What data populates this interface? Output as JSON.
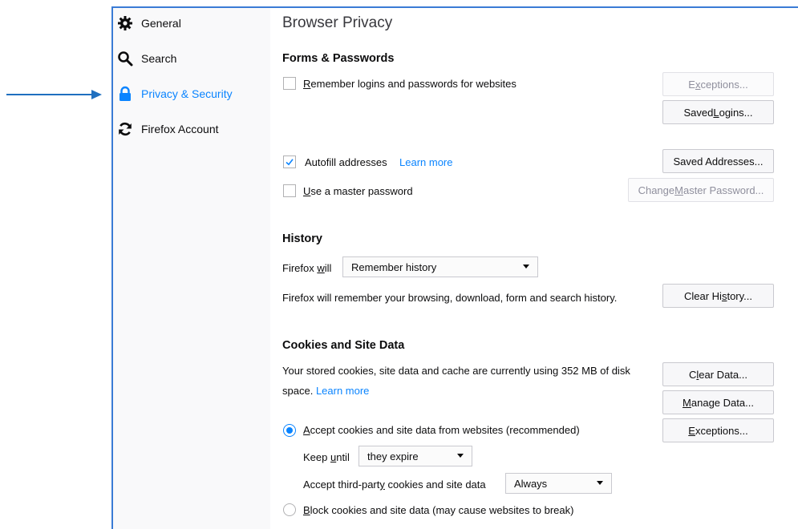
{
  "sidebar": {
    "items": [
      {
        "label": "General",
        "icon": "gear-icon"
      },
      {
        "label": "Search",
        "icon": "search-icon"
      },
      {
        "label": "Privacy & Security",
        "icon": "lock-icon",
        "selected": true
      },
      {
        "label": "Firefox Account",
        "icon": "sync-icon"
      }
    ]
  },
  "pane": {
    "title": "Browser Privacy"
  },
  "forms": {
    "heading": "Forms & Passwords",
    "remember_logins": {
      "pre": "",
      "u": "R",
      "post": "emember logins and passwords for websites",
      "checked": false
    },
    "exceptions_btn": {
      "pre": "E",
      "u": "x",
      "post": "ceptions..."
    },
    "saved_logins_btn": {
      "pre": "Saved ",
      "u": "L",
      "post": "ogins..."
    },
    "autofill": {
      "label": "Autofill addresses",
      "checked": true
    },
    "autofill_learn_more": "Learn more",
    "saved_addresses_btn": "Saved Addresses...",
    "master_password": {
      "pre": "",
      "u": "U",
      "post": "se a master password",
      "checked": false
    },
    "change_master_btn": {
      "pre": "Change ",
      "u": "M",
      "post": "aster Password..."
    }
  },
  "history": {
    "heading": "History",
    "will_label": {
      "pre": "Firefox ",
      "u": "w",
      "post": "ill"
    },
    "mode_select": "Remember history",
    "description": "Firefox will remember your browsing, download, form and search history.",
    "clear_btn": {
      "pre": "Clear Hi",
      "u": "s",
      "post": "tory..."
    }
  },
  "cookies": {
    "heading": "Cookies and Site Data",
    "desc_line1": "Your stored cookies, site data and cache are currently using 352 MB of disk",
    "desc_line2": "space.",
    "learn_more": "Learn more",
    "clear_data_btn": {
      "pre": "C",
      "u": "l",
      "post": "ear Data..."
    },
    "manage_data_btn": {
      "pre": "",
      "u": "M",
      "post": "anage Data..."
    },
    "exceptions_btn": {
      "pre": "",
      "u": "E",
      "post": "xceptions..."
    },
    "accept_radio": {
      "pre": "",
      "u": "A",
      "post": "ccept cookies and site data from websites (recommended)",
      "selected": true
    },
    "keep_until": {
      "pre": "Keep ",
      "u": "u",
      "post": "ntil",
      "value": "they expire"
    },
    "third_party": {
      "pre": "Accept third-part",
      "u": "y",
      "post": " cookies and site data",
      "value": "Always"
    },
    "block_radio": {
      "pre": "",
      "u": "B",
      "post": "lock cookies and site data (may cause websites to break)",
      "selected": false
    }
  },
  "colors": {
    "accent": "#0a84ff",
    "annotation_arrow": "#1f6fbf"
  }
}
